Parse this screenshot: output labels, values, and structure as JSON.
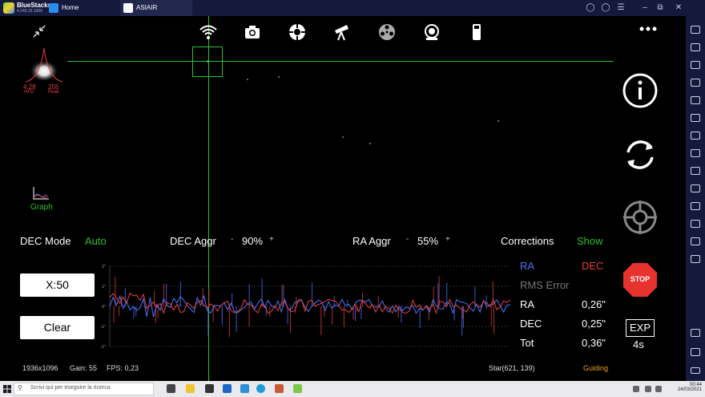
{
  "titlebar": {
    "app_name": "BlueStacks",
    "version": "4.240.15.1005",
    "tabs": [
      {
        "label": "Home"
      },
      {
        "label": "ASIAIR"
      }
    ]
  },
  "hfd": {
    "value": "4.28",
    "label": "HFD",
    "peak_value": "255",
    "peak_label": "Peak"
  },
  "graph_label": "Graph",
  "controls": {
    "dec_mode_label": "DEC Mode",
    "dec_mode_value": "Auto",
    "dec_aggr_label": "DEC Aggr",
    "dec_aggr_value": "90%",
    "ra_aggr_label": "RA Aggr",
    "ra_aggr_value": "55%",
    "minus": "-",
    "plus": "+",
    "corrections_label": "Corrections",
    "corrections_value": "Show"
  },
  "buttons": {
    "scale": "X:50",
    "clear": "Clear",
    "stop": "STOP"
  },
  "exposure": {
    "label": "EXP",
    "value": "4s"
  },
  "plot": {
    "y_ticks": [
      "2\"",
      "1\"",
      "0\"",
      "-1\"",
      "-2\""
    ]
  },
  "legend": {
    "ra": "RA",
    "dec": "DEC"
  },
  "rms": {
    "title": "RMS Error",
    "rows": [
      {
        "label": "RA",
        "value": "0,26\""
      },
      {
        "label": "DEC",
        "value": "0,25\""
      },
      {
        "label": "Tot",
        "value": "0,36\""
      }
    ]
  },
  "status": {
    "resolution": "1936x1096",
    "gain": "Gain: 55",
    "fps": "FPS: 0,23",
    "star": "Star(621, 139)",
    "state": "Guiding"
  },
  "taskbar": {
    "search_placeholder": "Scrivi qui per eseguire la ricerca",
    "time": "00:44",
    "date": "24/03/2021"
  },
  "colors": {
    "ra": "#4a73ff",
    "dec": "#e43e3e",
    "accent": "#2fbf2f",
    "stop": "#e8322e"
  }
}
